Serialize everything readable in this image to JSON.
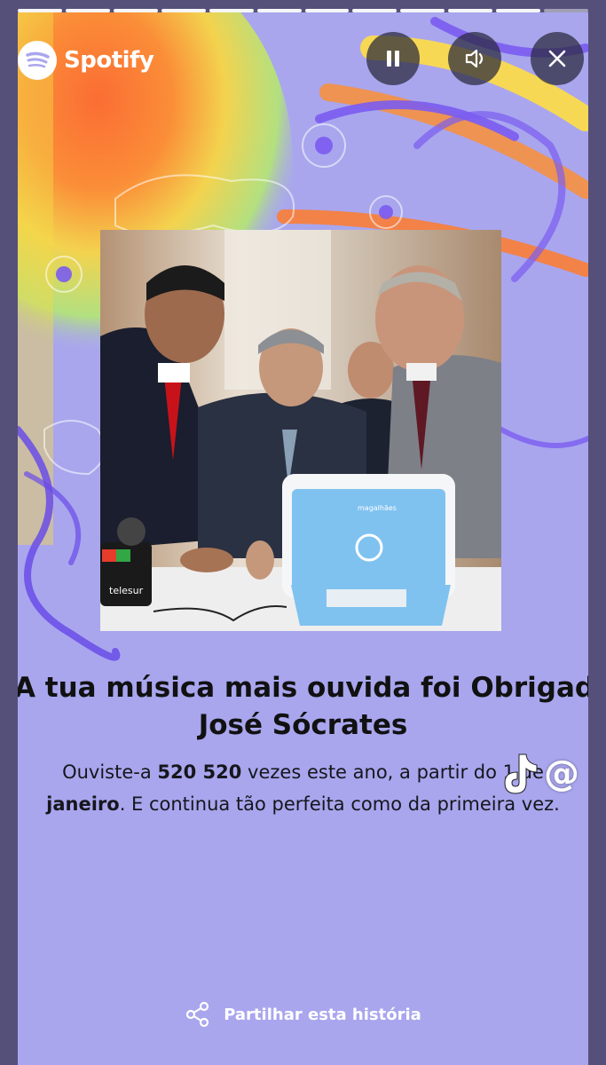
{
  "app": {
    "brand_name": "Spotify"
  },
  "story": {
    "progress": {
      "total_segments": 12,
      "completed_segments": 11
    },
    "title_line1": "A tua música mais ouvida foi Obrigado",
    "title_line2": "José Sócrates",
    "body": {
      "part1": "Ouviste-a ",
      "count": "520 520",
      "part2": " vezes este ano, a partir do 1 de ",
      "month": "janeiro",
      "part3": ". E continua tão perfeita como da primeira vez."
    },
    "share_label": "Partilhar esta história"
  },
  "controls": {
    "pause_icon": "pause-icon",
    "sound_icon": "speaker-icon",
    "close_icon": "close-icon"
  },
  "watermark": {
    "tiktok_icon": "tiktok-icon",
    "at_symbol": "@"
  },
  "photo": {
    "icon": "photo-of-four-men-with-laptop",
    "mic_label": "telesur",
    "laptop_label": "magalhães"
  },
  "colors": {
    "card_bg": "#a9a6ee",
    "frame_bg": "#55507a",
    "laptop_blue": "#7fc2f0",
    "art_purple": "#7a5cf0",
    "art_orange": "#ff8a2a",
    "art_yellow": "#f5e84a"
  }
}
